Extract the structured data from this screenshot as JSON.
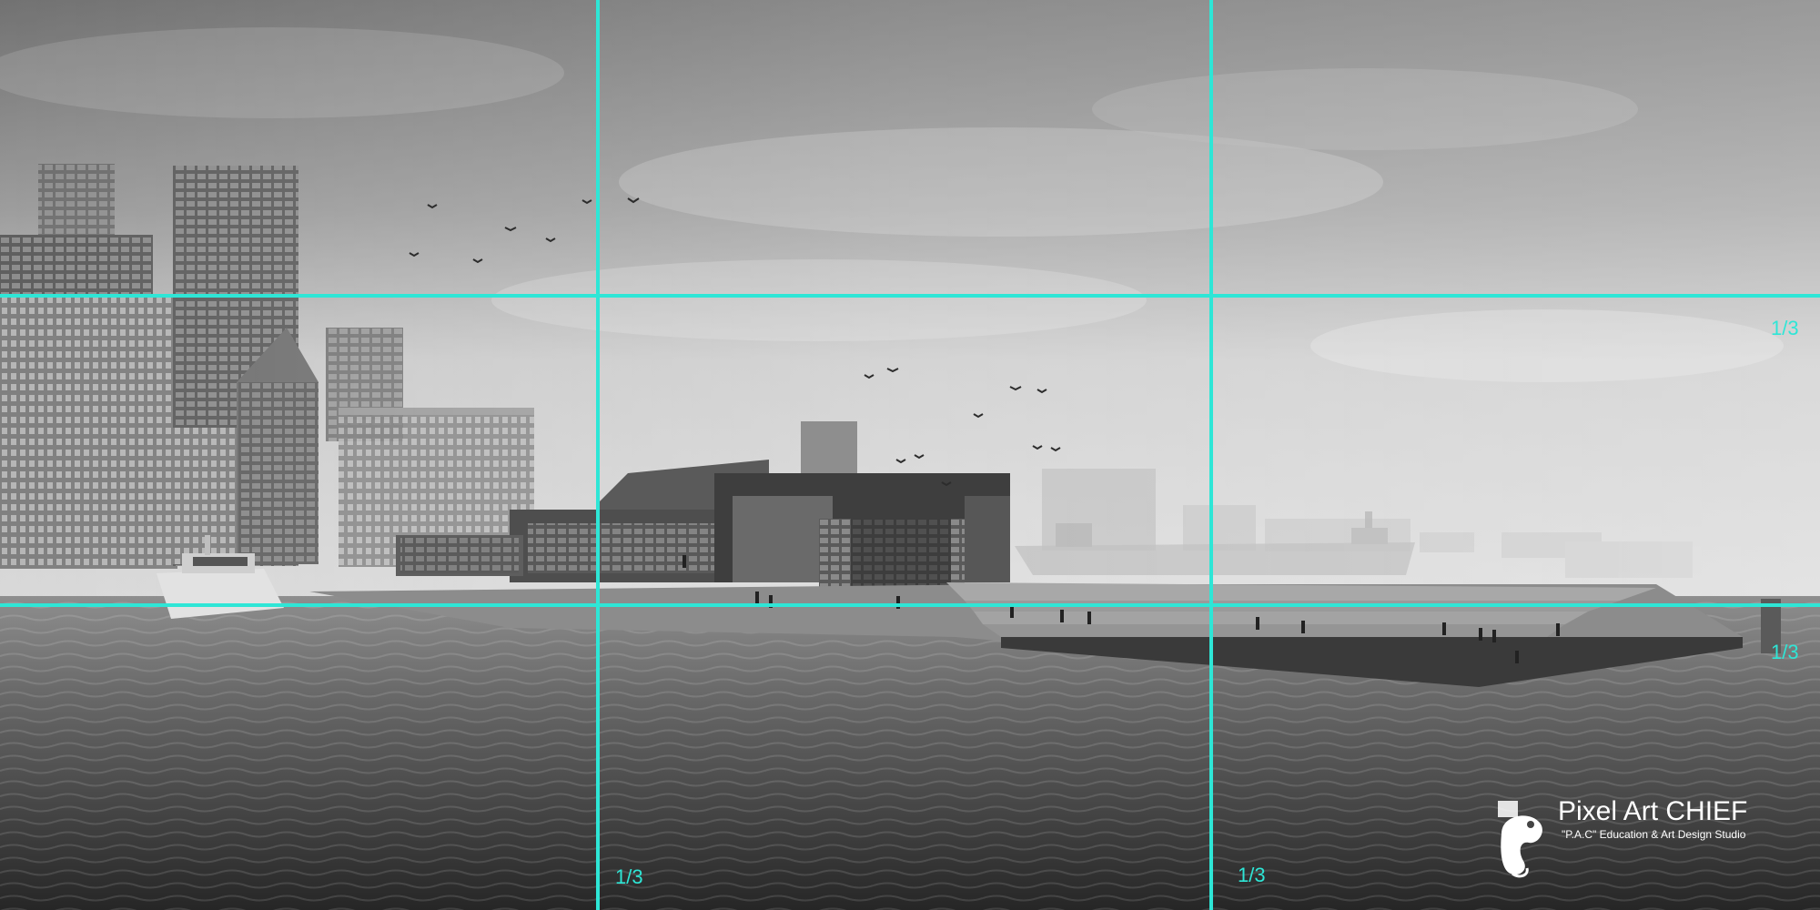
{
  "photo": {
    "kind": "architectural-rendering",
    "palette": "grayscale",
    "subject": "waterfront cultural building with stepped public pier"
  },
  "overlay": {
    "type": "rule-of-thirds-grid",
    "grid_color": "#2ee6d6",
    "labels": [
      "1/3",
      "1/3",
      "1/3",
      "1/3"
    ]
  },
  "watermark": {
    "title": "Pixel Art CHIEF",
    "subtitle": "\"P.A.C\" Education & Art Design Studio",
    "icon": "chameleon-logo-icon"
  }
}
